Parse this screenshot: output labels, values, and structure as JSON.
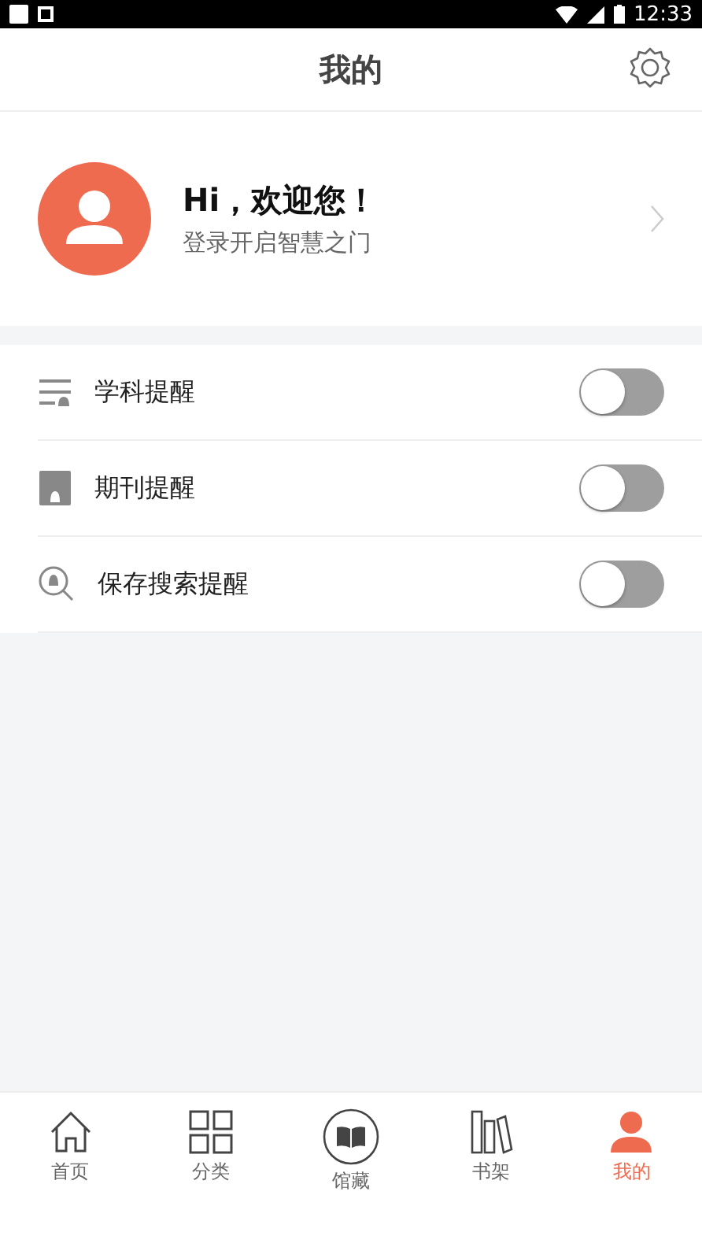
{
  "status_bar": {
    "time": "12:33"
  },
  "header": {
    "title": "我的"
  },
  "profile": {
    "greeting": "Hi，欢迎您！",
    "subtitle": "登录开启智慧之门"
  },
  "reminders": [
    {
      "label": "学科提醒",
      "on": false
    },
    {
      "label": "期刊提醒",
      "on": false
    },
    {
      "label": "保存搜索提醒",
      "on": false
    }
  ],
  "tabs": [
    {
      "label": "首页",
      "selected": false
    },
    {
      "label": "分类",
      "selected": false
    },
    {
      "label": "馆藏",
      "selected": false
    },
    {
      "label": "书架",
      "selected": false
    },
    {
      "label": "我的",
      "selected": true
    }
  ]
}
